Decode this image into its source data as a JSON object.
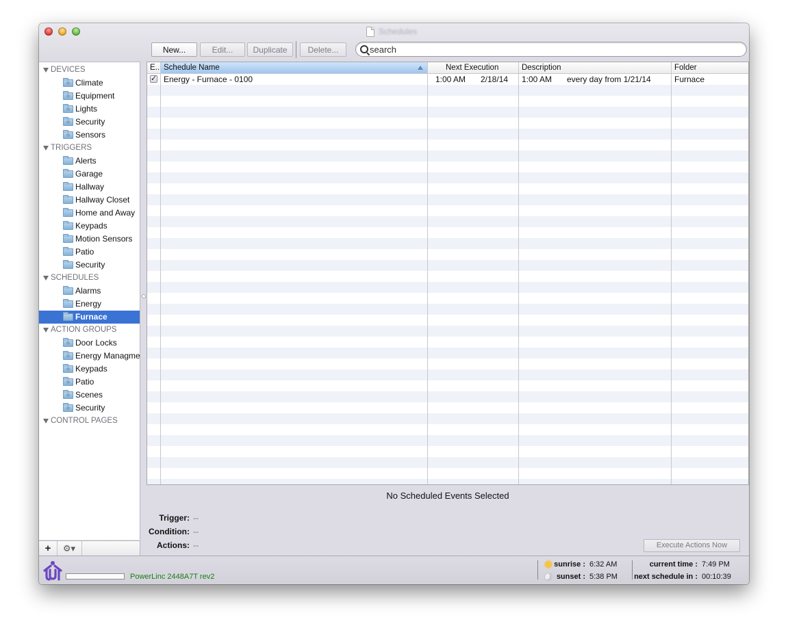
{
  "window": {
    "title": "Schedules"
  },
  "toolbar": {
    "new_label": "New...",
    "edit_label": "Edit...",
    "duplicate_label": "Duplicate",
    "delete_label": "Delete...",
    "search_placeholder": "search",
    "search_value": ""
  },
  "sidebar": {
    "sections": [
      {
        "title": "DEVICES",
        "folder_style": "device",
        "items": [
          "Climate",
          "Equipment",
          "Lights",
          "Security",
          "Sensors"
        ]
      },
      {
        "title": "TRIGGERS",
        "folder_style": "plain",
        "items": [
          "Alerts",
          "Garage",
          "Hallway",
          "Hallway Closet",
          "Home and Away",
          "Keypads",
          "Motion Sensors",
          "Patio",
          "Security"
        ]
      },
      {
        "title": "SCHEDULES",
        "folder_style": "plain",
        "items": [
          "Alarms",
          "Energy",
          "Furnace"
        ],
        "selected": "Furnace"
      },
      {
        "title": "ACTION GROUPS",
        "folder_style": "device",
        "items": [
          "Door Locks",
          "Energy Managment",
          "Keypads",
          "Patio",
          "Scenes",
          "Security"
        ]
      },
      {
        "title": "CONTROL PAGES",
        "folder_style": "plain",
        "items": []
      }
    ],
    "add_label": "+",
    "gear_label": "⚙▾"
  },
  "table": {
    "columns": [
      {
        "key": "enabled",
        "label": "E.."
      },
      {
        "key": "name",
        "label": "Schedule Name",
        "sorted": "ascending"
      },
      {
        "key": "next_execution",
        "label": "Next Execution"
      },
      {
        "key": "description",
        "label": "Description"
      },
      {
        "key": "folder",
        "label": "Folder"
      }
    ],
    "rows": [
      {
        "enabled": true,
        "name": "Energy - Furnace - 0100",
        "next_time": "1:00 AM",
        "next_date": "2/18/14",
        "desc_time": "1:00 AM",
        "desc_text": "every day from 1/21/14",
        "folder": "Furnace"
      }
    ]
  },
  "detail": {
    "title": "No Scheduled Events Selected",
    "trigger_label": "Trigger:",
    "trigger_value": "--",
    "condition_label": "Condition:",
    "condition_value": "--",
    "actions_label": "Actions:",
    "actions_value": "--",
    "execute_label": "Execute Actions Now"
  },
  "status": {
    "device": "PowerLinc 2448A7T rev2",
    "sunrise_label": "sunrise :",
    "sunrise_value": "6:32 AM",
    "sunset_label": "sunset :",
    "sunset_value": "5:38 PM",
    "current_time_label": "current time :",
    "current_time_value": "7:49 PM",
    "next_schedule_label": "next schedule in :",
    "next_schedule_value": "00:10:39",
    "progress": 0
  },
  "colors": {
    "selection": "#3b73d4",
    "device_text": "#1c7a16",
    "logo": "#6b46c1"
  }
}
